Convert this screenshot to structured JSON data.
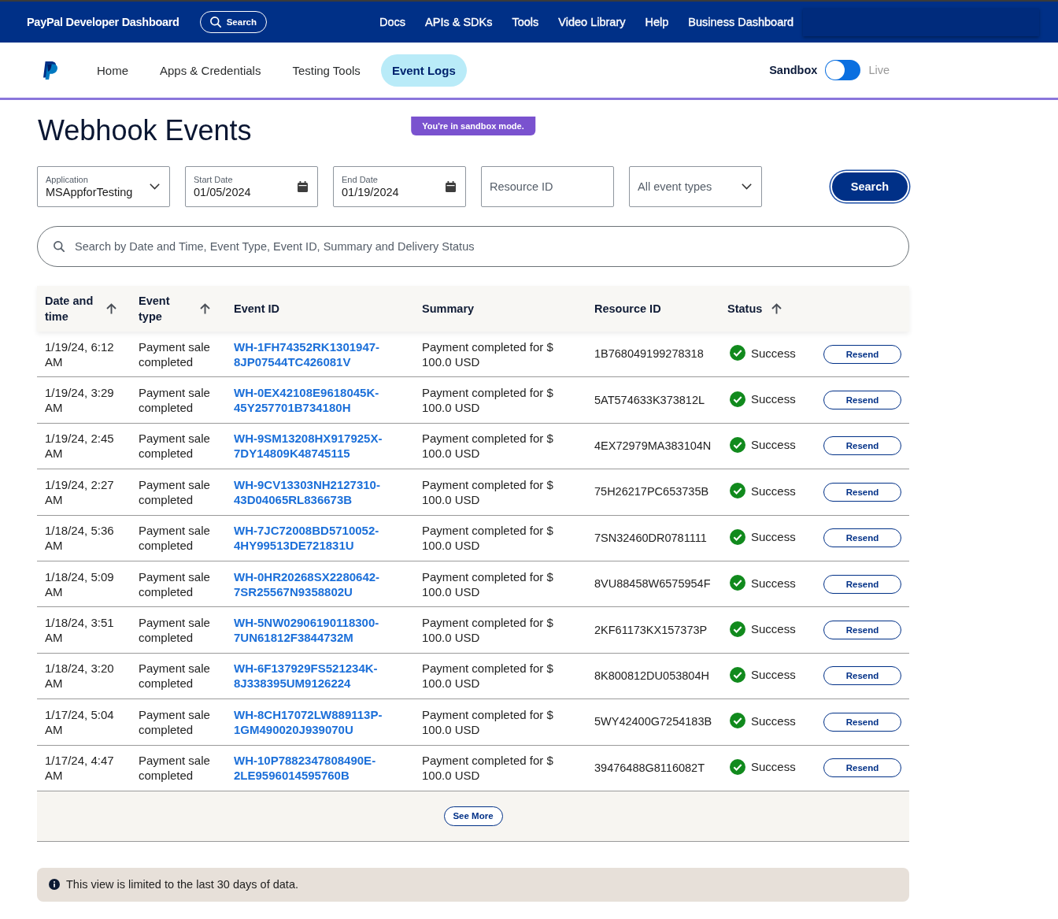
{
  "top_bar": {
    "brand": "PayPal Developer Dashboard",
    "search_button": "Search",
    "links": [
      "Docs",
      "APIs & SDKs",
      "Tools",
      "Video Library",
      "Help",
      "Business Dashboard"
    ]
  },
  "sub_nav": {
    "items": [
      {
        "label": "Home",
        "selected": false
      },
      {
        "label": "Apps & Credentials",
        "selected": false
      },
      {
        "label": "Testing Tools",
        "selected": false
      },
      {
        "label": "Event Logs",
        "selected": true
      }
    ],
    "environment": {
      "options": [
        {
          "label": "Sandbox",
          "selected": true
        },
        {
          "label": "Live",
          "selected": false
        }
      ]
    }
  },
  "sandbox_notice": "You're in sandbox mode.",
  "page_title": "Webhook Events",
  "filters": [
    {
      "kind": "dropdown",
      "label": "Application",
      "value": "MSAppforTesting"
    },
    {
      "kind": "date",
      "label": "Start Date",
      "value": "01/05/2024"
    },
    {
      "kind": "date",
      "label": "End Date",
      "value": "01/19/2024"
    },
    {
      "kind": "text",
      "placeholder": "Resource ID"
    },
    {
      "kind": "dropdown",
      "value": "All event types"
    }
  ],
  "search_button": "Search",
  "search_field": {
    "placeholder": "Search by Date and Time, Event Type, Event ID, Summary and Delivery Status"
  },
  "table": {
    "columns": [
      {
        "label": "Date and time",
        "sortable": true
      },
      {
        "label": "Event type",
        "sortable": true
      },
      {
        "label": "Event ID",
        "sortable": false
      },
      {
        "label": "Summary",
        "sortable": false
      },
      {
        "label": "Resource ID",
        "sortable": false
      },
      {
        "label": "Status",
        "sortable": true
      }
    ],
    "rows": [
      {
        "date_time": "1/19/24, 6:12 AM",
        "event_type": "Payment sale completed",
        "event_id": "WH-1FH74352RK1301947-8JP07544TC426081V",
        "summary": "Payment completed for $ 100.0 USD",
        "resource_id": "1B768049199278318",
        "status": "Success",
        "action": "Resend"
      },
      {
        "date_time": "1/19/24, 3:29 AM",
        "event_type": "Payment sale completed",
        "event_id": "WH-0EX42108E9618045K-45Y257701B734180H",
        "summary": "Payment completed for $ 100.0 USD",
        "resource_id": "5AT574633K373812L",
        "status": "Success",
        "action": "Resend"
      },
      {
        "date_time": "1/19/24, 2:45 AM",
        "event_type": "Payment sale completed",
        "event_id": "WH-9SM13208HX917925X-7DY14809K48745115",
        "summary": "Payment completed for $ 100.0 USD",
        "resource_id": "4EX72979MA383104N",
        "status": "Success",
        "action": "Resend"
      },
      {
        "date_time": "1/19/24, 2:27 AM",
        "event_type": "Payment sale completed",
        "event_id": "WH-9CV13303NH2127310-43D04065RL836673B",
        "summary": "Payment completed for $ 100.0 USD",
        "resource_id": "75H26217PC653735B",
        "status": "Success",
        "action": "Resend"
      },
      {
        "date_time": "1/18/24, 5:36 AM",
        "event_type": "Payment sale completed",
        "event_id": "WH-7JC72008BD5710052-4HY99513DE721831U",
        "summary": "Payment completed for $ 100.0 USD",
        "resource_id": "7SN32460DR0781111",
        "status": "Success",
        "action": "Resend"
      },
      {
        "date_time": "1/18/24, 5:09 AM",
        "event_type": "Payment sale completed",
        "event_id": "WH-0HR20268SX2280642-7SR25567N9358802U",
        "summary": "Payment completed for $ 100.0 USD",
        "resource_id": "8VU88458W6575954F",
        "status": "Success",
        "action": "Resend"
      },
      {
        "date_time": "1/18/24, 3:51 AM",
        "event_type": "Payment sale completed",
        "event_id": "WH-5NW02906190118300-7UN61812F3844732M",
        "summary": "Payment completed for $ 100.0 USD",
        "resource_id": "2KF61173KX157373P",
        "status": "Success",
        "action": "Resend"
      },
      {
        "date_time": "1/18/24, 3:20 AM",
        "event_type": "Payment sale completed",
        "event_id": "WH-6F137929FS521234K-8J338395UM9126224",
        "summary": "Payment completed for $ 100.0 USD",
        "resource_id": "8K800812DU053804H",
        "status": "Success",
        "action": "Resend"
      },
      {
        "date_time": "1/17/24, 5:04 AM",
        "event_type": "Payment sale completed",
        "event_id": "WH-8CH17072LW889113P-1GM490020J939070U",
        "summary": "Payment completed for $ 100.0 USD",
        "resource_id": "5WY42400G7254183B",
        "status": "Success",
        "action": "Resend"
      },
      {
        "date_time": "1/17/24, 4:47 AM",
        "event_type": "Payment sale completed",
        "event_id": "WH-10P7882347808490E-2LE9596014595760B",
        "summary": "Payment completed for $ 100.0 USD",
        "resource_id": "39476488G8116082T",
        "status": "Success",
        "action": "Resend"
      }
    ]
  },
  "see_more_button": "See More",
  "info_banner": "This view is limited to the last 30 days of data."
}
